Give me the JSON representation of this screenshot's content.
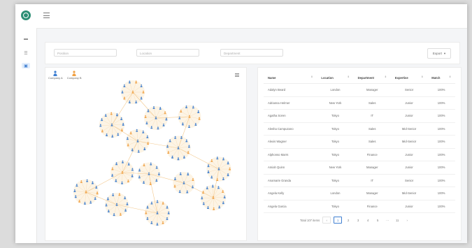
{
  "filters": {
    "position": "Position",
    "location": "Location",
    "department": "Department",
    "export": "Export"
  },
  "legend": [
    {
      "label": "Company A",
      "color": "#3f7fd1"
    },
    {
      "label": "Company B",
      "color": "#f0a145"
    }
  ],
  "table": {
    "headers": [
      "Name",
      "Location",
      "Department",
      "Expertise",
      "Match"
    ],
    "rows": [
      [
        "Adalyn Beard",
        "London",
        "Manager",
        "Senior",
        "100%"
      ],
      [
        "Adrianna Helmer",
        "New York",
        "Sales",
        "Junior",
        "100%"
      ],
      [
        "Agatha Soren",
        "Tokyo",
        "IT",
        "Junior",
        "100%"
      ],
      [
        "Alesha Campuzano",
        "Tokyo",
        "Sales",
        "Mid-Senior",
        "100%"
      ],
      [
        "Alexis Wagner",
        "Tokyo",
        "Sales",
        "Mid-Senior",
        "100%"
      ],
      [
        "Alphonso Marrs",
        "Tokyo",
        "Finance",
        "Junior",
        "100%"
      ],
      [
        "Amiah Quinn",
        "New York",
        "Manager",
        "Junior",
        "100%"
      ],
      [
        "Anamarie Granda",
        "Tokyo",
        "IT",
        "Senior",
        "100%"
      ],
      [
        "Angela Kelly",
        "London",
        "Manager",
        "Mid-Senior",
        "100%"
      ],
      [
        "Angela Garcia",
        "Tokyo",
        "Finance",
        "Junior",
        "100%"
      ]
    ]
  },
  "pagination": {
    "total": "Total 107 items",
    "prev": "‹",
    "pages": [
      "1",
      "2",
      "3",
      "4",
      "5"
    ],
    "ellipsis": "···",
    "last": "11",
    "next": "›"
  },
  "icons": {
    "sort": "sort-arrows-icon",
    "chevron": "chevron-down-icon"
  }
}
